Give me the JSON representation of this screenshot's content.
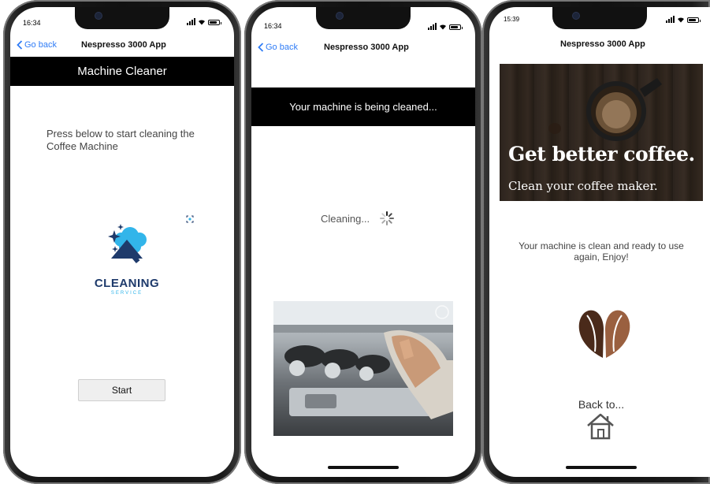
{
  "screens": [
    {
      "time": "16:34",
      "back_label": "Go back",
      "app_title": "Nespresso 3000 App",
      "header": "Machine Cleaner",
      "prompt": "Press below to start cleaning the Coffee Machine",
      "logo": {
        "main": "CLEANING",
        "sub": "SERVICE"
      },
      "start_label": "Start"
    },
    {
      "time": "16:34",
      "back_label": "Go back",
      "app_title": "Nespresso 3000 App",
      "header": "Your machine is being cleaned...",
      "status": "Cleaning..."
    },
    {
      "time": "15:39",
      "app_title": "Nespresso 3000 App",
      "hero_title": "Get better coffee.",
      "hero_subtitle": "Clean your coffee maker.",
      "message": "Your machine is clean and ready to use again, Enjoy!",
      "back_to": "Back to..."
    }
  ],
  "colors": {
    "link": "#2f7cf6",
    "header_bg": "#000000",
    "logo_blue": "#1e3a6b",
    "logo_accent": "#32b5ea",
    "bean": "#7a4a2c"
  }
}
